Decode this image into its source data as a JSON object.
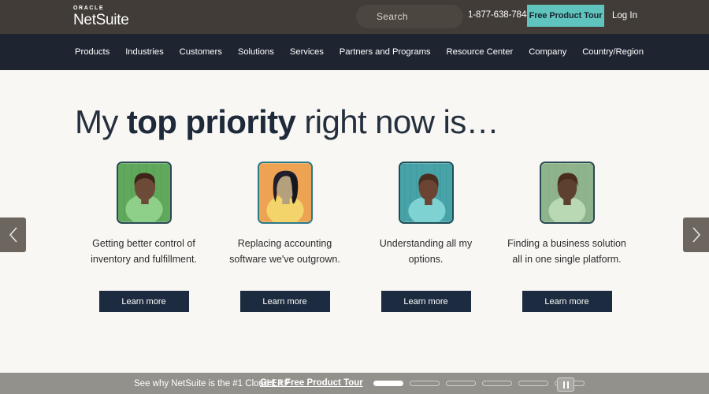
{
  "topbar": {
    "logo_brand": "ORACLE",
    "logo_product": "NetSuite",
    "search_placeholder": "Search",
    "phone": "1-877-638-7848",
    "tour_button": "Free Product Tour",
    "login": "Log In"
  },
  "nav": {
    "items": [
      {
        "label": "Products"
      },
      {
        "label": "Industries"
      },
      {
        "label": "Customers"
      },
      {
        "label": "Solutions"
      },
      {
        "label": "Services"
      },
      {
        "label": "Partners and Programs"
      },
      {
        "label": "Resource Center"
      },
      {
        "label": "Company"
      },
      {
        "label": "Country/Region"
      }
    ]
  },
  "hero": {
    "headline_prefix": "My ",
    "headline_bold": "top priority",
    "headline_suffix": " right now is…",
    "cards": [
      {
        "caption": "Getting better control of inventory and fulfillment.",
        "button": "Learn more",
        "bg_color": "#5fa85c",
        "skin_color": "#6d4a38",
        "hair_color": "#3e2418",
        "shirt_color": "#8ed08a",
        "frame_color": "#2a4a55"
      },
      {
        "caption": "Replacing accounting software we've outgrown.",
        "button": "Learn more",
        "bg_color": "#eda352",
        "skin_color": "#b5a07e",
        "hair_color": "#211f2b",
        "shirt_color": "#f2d46b",
        "frame_color": "#2a7a88"
      },
      {
        "caption": "Understanding all my options.",
        "button": "Learn more",
        "bg_color": "#47a3a8",
        "skin_color": "#6b4433",
        "hair_color": "#4a2e20",
        "shirt_color": "#7fd2d2",
        "frame_color": "#1f4e58"
      },
      {
        "caption": "Finding a business solution all in one single platform.",
        "button": "Learn more",
        "bg_color": "#8fb48c",
        "skin_color": "#5d4030",
        "hair_color": "#4a2c1d",
        "shirt_color": "#b9d8b4",
        "frame_color": "#2a4a55"
      }
    ]
  },
  "carousel": {
    "prev_icon": "chevron-left-icon",
    "next_icon": "chevron-right-icon",
    "slide_count": 6,
    "active_slide": 1,
    "pause_icon": "pause-icon"
  },
  "bottombar": {
    "text": "See why NetSuite is the #1 Cloud ERP",
    "link": "Get a Free Product Tour"
  },
  "colors": {
    "topbar_bg": "#413c37",
    "navbar_bg": "#1e2430",
    "hero_bg": "#f9f7f3",
    "accent_teal": "#5fc4bd",
    "button_navy": "#1c2b3f",
    "bottombar_bg": "#93918c"
  }
}
